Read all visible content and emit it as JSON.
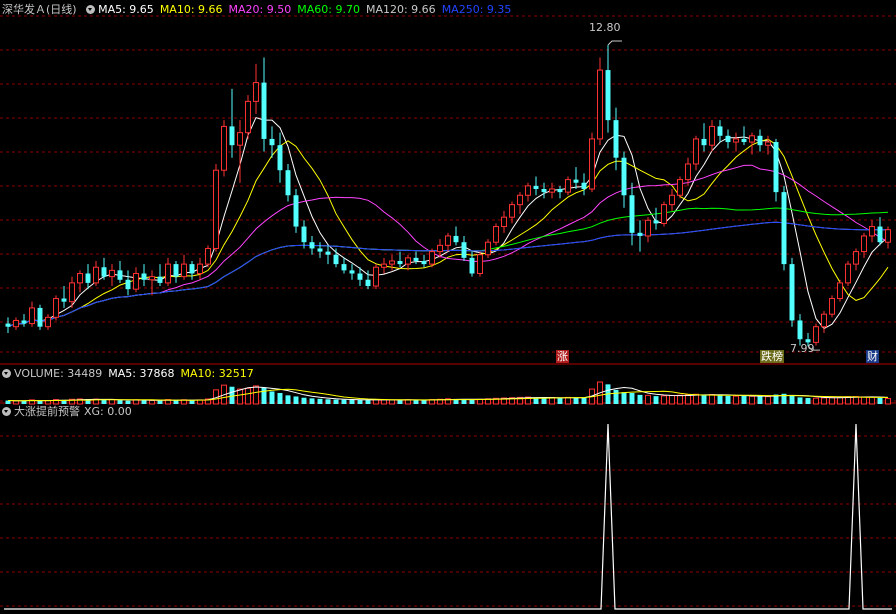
{
  "main_panel": {
    "stock_name": "深华发Ａ",
    "period": "(日线)",
    "indicators": [
      {
        "label": "MA5: 9.65",
        "color": "#ffffff"
      },
      {
        "label": "MA10: 9.66",
        "color": "#ffff00"
      },
      {
        "label": "MA20: 9.50",
        "color": "#ff44ff"
      },
      {
        "label": "MA60: 9.70",
        "color": "#00ff00"
      },
      {
        "label": "MA120: 9.66",
        "color": "#c8c8c8"
      },
      {
        "label": "MA250: 9.35",
        "color": "#2244ff"
      }
    ],
    "high_label": "12.80",
    "low_label": "7.99",
    "signal_tags": [
      {
        "text": "涨",
        "bg": "#b01c1c",
        "fg": "#ffffff"
      },
      {
        "text": "跌榜",
        "bg": "#6b6b1a",
        "fg": "#ffffff"
      },
      {
        "text": "财",
        "bg": "#1a3a8a",
        "fg": "#ffffff"
      }
    ]
  },
  "volume_panel": {
    "title": "VOLUME: 34489",
    "ma5": "MA5: 37868",
    "ma10": "MA10: 32517"
  },
  "indicator_panel": {
    "title": "大涨提前预警",
    "xg": "XG: 0.00"
  },
  "colors": {
    "up": "#ff3232",
    "down": "#54ffff",
    "grid": "#8b0000",
    "ma5": "#ffffff",
    "ma10": "#ffff00",
    "ma20": "#ff44ff",
    "ma60": "#00ff00",
    "ma120": "#c8c8c8",
    "ma250": "#2244ff"
  },
  "chart_data": [
    {
      "type": "candlestick",
      "title": "深华发Ａ (日线)",
      "y_range": [
        7.8,
        13.2
      ],
      "high_marker": 12.8,
      "low_marker": 7.99,
      "candles": [
        [
          8.35,
          8.45,
          8.2,
          8.3
        ],
        [
          8.3,
          8.45,
          8.25,
          8.4
        ],
        [
          8.4,
          8.5,
          8.3,
          8.35
        ],
        [
          8.35,
          8.7,
          8.3,
          8.6
        ],
        [
          8.6,
          8.65,
          8.25,
          8.3
        ],
        [
          8.3,
          8.5,
          8.25,
          8.45
        ],
        [
          8.45,
          8.8,
          8.4,
          8.75
        ],
        [
          8.75,
          8.95,
          8.6,
          8.7
        ],
        [
          8.7,
          9.1,
          8.6,
          9.0
        ],
        [
          9.0,
          9.2,
          8.85,
          9.15
        ],
        [
          9.15,
          9.3,
          8.9,
          9.0
        ],
        [
          9.0,
          9.35,
          8.95,
          9.25
        ],
        [
          9.25,
          9.4,
          9.05,
          9.1
        ],
        [
          9.1,
          9.3,
          8.95,
          9.2
        ],
        [
          9.2,
          9.35,
          9.0,
          9.05
        ],
        [
          9.05,
          9.2,
          8.8,
          8.9
        ],
        [
          8.9,
          9.25,
          8.85,
          9.15
        ],
        [
          9.15,
          9.3,
          8.95,
          9.05
        ],
        [
          9.05,
          9.2,
          8.8,
          9.1
        ],
        [
          9.1,
          9.3,
          8.95,
          9.0
        ],
        [
          9.0,
          9.4,
          8.95,
          9.3
        ],
        [
          9.3,
          9.35,
          9.0,
          9.1
        ],
        [
          9.1,
          9.45,
          9.05,
          9.3
        ],
        [
          9.3,
          9.35,
          9.05,
          9.15
        ],
        [
          9.15,
          9.4,
          9.05,
          9.3
        ],
        [
          9.3,
          9.6,
          9.25,
          9.55
        ],
        [
          9.55,
          10.9,
          9.5,
          10.8
        ],
        [
          10.8,
          11.6,
          10.7,
          11.5
        ],
        [
          11.5,
          12.1,
          11.0,
          11.2
        ],
        [
          11.2,
          11.6,
          10.6,
          11.4
        ],
        [
          11.4,
          12.0,
          11.3,
          11.9
        ],
        [
          11.9,
          12.5,
          11.7,
          12.2
        ],
        [
          12.2,
          12.6,
          11.1,
          11.3
        ],
        [
          11.3,
          11.5,
          11.0,
          11.2
        ],
        [
          11.2,
          11.4,
          10.6,
          10.8
        ],
        [
          10.8,
          10.9,
          10.3,
          10.4
        ],
        [
          10.4,
          10.5,
          9.8,
          9.9
        ],
        [
          9.9,
          10.0,
          9.55,
          9.65
        ],
        [
          9.65,
          9.75,
          9.45,
          9.55
        ],
        [
          9.55,
          9.65,
          9.4,
          9.5
        ],
        [
          9.5,
          9.6,
          9.3,
          9.45
        ],
        [
          9.45,
          9.55,
          9.25,
          9.3
        ],
        [
          9.3,
          9.4,
          9.15,
          9.2
        ],
        [
          9.2,
          9.3,
          9.05,
          9.15
        ],
        [
          9.15,
          9.25,
          8.95,
          9.05
        ],
        [
          9.05,
          9.2,
          8.9,
          8.95
        ],
        [
          8.95,
          9.3,
          8.9,
          9.25
        ],
        [
          9.25,
          9.4,
          9.15,
          9.3
        ],
        [
          9.3,
          9.45,
          9.2,
          9.35
        ],
        [
          9.35,
          9.5,
          9.25,
          9.3
        ],
        [
          9.3,
          9.45,
          9.2,
          9.4
        ],
        [
          9.4,
          9.5,
          9.3,
          9.35
        ],
        [
          9.35,
          9.45,
          9.25,
          9.3
        ],
        [
          9.3,
          9.55,
          9.25,
          9.5
        ],
        [
          9.5,
          9.7,
          9.4,
          9.6
        ],
        [
          9.6,
          9.8,
          9.5,
          9.75
        ],
        [
          9.75,
          9.9,
          9.6,
          9.65
        ],
        [
          9.65,
          9.75,
          9.35,
          9.4
        ],
        [
          9.4,
          9.5,
          9.1,
          9.15
        ],
        [
          9.15,
          9.5,
          9.1,
          9.45
        ],
        [
          9.45,
          9.7,
          9.4,
          9.65
        ],
        [
          9.65,
          9.95,
          9.6,
          9.9
        ],
        [
          9.9,
          10.15,
          9.8,
          10.05
        ],
        [
          10.05,
          10.3,
          9.95,
          10.25
        ],
        [
          10.25,
          10.45,
          10.1,
          10.4
        ],
        [
          10.4,
          10.6,
          10.3,
          10.55
        ],
        [
          10.55,
          10.7,
          10.4,
          10.5
        ],
        [
          10.5,
          10.6,
          10.35,
          10.45
        ],
        [
          10.45,
          10.6,
          10.35,
          10.5
        ],
        [
          10.5,
          10.55,
          10.35,
          10.45
        ],
        [
          10.45,
          10.7,
          10.4,
          10.65
        ],
        [
          10.65,
          10.85,
          10.5,
          10.6
        ],
        [
          10.6,
          10.75,
          10.4,
          10.5
        ],
        [
          10.5,
          11.4,
          10.45,
          11.3
        ],
        [
          11.3,
          12.6,
          11.2,
          12.4
        ],
        [
          12.4,
          12.8,
          11.4,
          11.6
        ],
        [
          11.6,
          11.8,
          10.8,
          11.0
        ],
        [
          11.0,
          11.1,
          10.2,
          10.4
        ],
        [
          10.4,
          10.6,
          9.6,
          9.8
        ],
        [
          9.8,
          10.0,
          9.5,
          9.75
        ],
        [
          9.75,
          10.05,
          9.65,
          10.0
        ],
        [
          10.0,
          10.2,
          9.85,
          9.95
        ],
        [
          9.95,
          10.3,
          9.9,
          10.25
        ],
        [
          10.25,
          10.5,
          10.15,
          10.4
        ],
        [
          10.4,
          10.7,
          10.35,
          10.65
        ],
        [
          10.65,
          11.0,
          10.55,
          10.9
        ],
        [
          10.9,
          11.35,
          10.8,
          11.3
        ],
        [
          11.3,
          11.55,
          11.1,
          11.2
        ],
        [
          11.2,
          11.6,
          11.1,
          11.5
        ],
        [
          11.5,
          11.6,
          11.25,
          11.35
        ],
        [
          11.35,
          11.45,
          11.15,
          11.25
        ],
        [
          11.25,
          11.4,
          11.1,
          11.3
        ],
        [
          11.3,
          11.5,
          11.2,
          11.25
        ],
        [
          11.25,
          11.4,
          11.05,
          11.35
        ],
        [
          11.35,
          11.45,
          11.1,
          11.2
        ],
        [
          11.2,
          11.35,
          11.05,
          11.25
        ],
        [
          11.25,
          11.3,
          10.3,
          10.45
        ],
        [
          10.45,
          10.55,
          9.2,
          9.3
        ],
        [
          9.3,
          9.4,
          8.3,
          8.4
        ],
        [
          8.4,
          8.5,
          8.0,
          8.1
        ],
        [
          8.1,
          8.2,
          7.99,
          8.05
        ],
        [
          8.05,
          8.35,
          8.0,
          8.3
        ],
        [
          8.3,
          8.55,
          8.2,
          8.5
        ],
        [
          8.5,
          8.8,
          8.45,
          8.75
        ],
        [
          8.75,
          9.05,
          8.7,
          9.0
        ],
        [
          9.0,
          9.35,
          8.95,
          9.3
        ],
        [
          9.3,
          9.55,
          9.2,
          9.5
        ],
        [
          9.5,
          9.8,
          9.4,
          9.75
        ],
        [
          9.75,
          10.0,
          9.65,
          9.9
        ],
        [
          9.9,
          10.05,
          9.6,
          9.65
        ],
        [
          9.65,
          9.9,
          9.55,
          9.85
        ]
      ],
      "series": [
        {
          "name": "MA5",
          "value": 9.65
        },
        {
          "name": "MA10",
          "value": 9.66
        },
        {
          "name": "MA20",
          "value": 9.5
        },
        {
          "name": "MA60",
          "value": 9.7
        },
        {
          "name": "MA120",
          "value": 9.66
        },
        {
          "name": "MA250",
          "value": 9.35
        }
      ]
    },
    {
      "type": "bar",
      "title": "VOLUME",
      "last_value": 34489,
      "ma5": 37868,
      "ma10": 32517,
      "values": [
        22000,
        20000,
        21000,
        26000,
        19000,
        22000,
        28000,
        25000,
        30000,
        32000,
        27000,
        31000,
        26000,
        29000,
        25000,
        21000,
        27000,
        24000,
        23000,
        22000,
        28000,
        23000,
        27000,
        24000,
        26000,
        32000,
        90000,
        120000,
        110000,
        95000,
        100000,
        115000,
        105000,
        80000,
        70000,
        55000,
        48000,
        40000,
        36000,
        33000,
        30000,
        28000,
        27000,
        26000,
        25000,
        24000,
        29000,
        27000,
        26000,
        25000,
        27000,
        26000,
        24000,
        28000,
        30000,
        33000,
        31000,
        29000,
        27000,
        30000,
        33000,
        36000,
        38000,
        40000,
        42000,
        44000,
        41000,
        39000,
        40000,
        38000,
        42000,
        41000,
        39000,
        95000,
        140000,
        125000,
        90000,
        75000,
        70000,
        58000,
        55000,
        50000,
        52000,
        54000,
        56000,
        58000,
        62000,
        59000,
        60000,
        57000,
        52000,
        50000,
        51000,
        49000,
        48000,
        47000,
        60000,
        65000,
        55000,
        42000,
        38000,
        37000,
        39000,
        41000,
        43000,
        46000,
        47000,
        45000,
        44000,
        40000,
        34489
      ]
    },
    {
      "type": "line",
      "title": "大涨提前预警",
      "y_range": [
        0,
        1
      ],
      "spike_indices": [
        75,
        106
      ],
      "last_value": 0.0
    }
  ]
}
